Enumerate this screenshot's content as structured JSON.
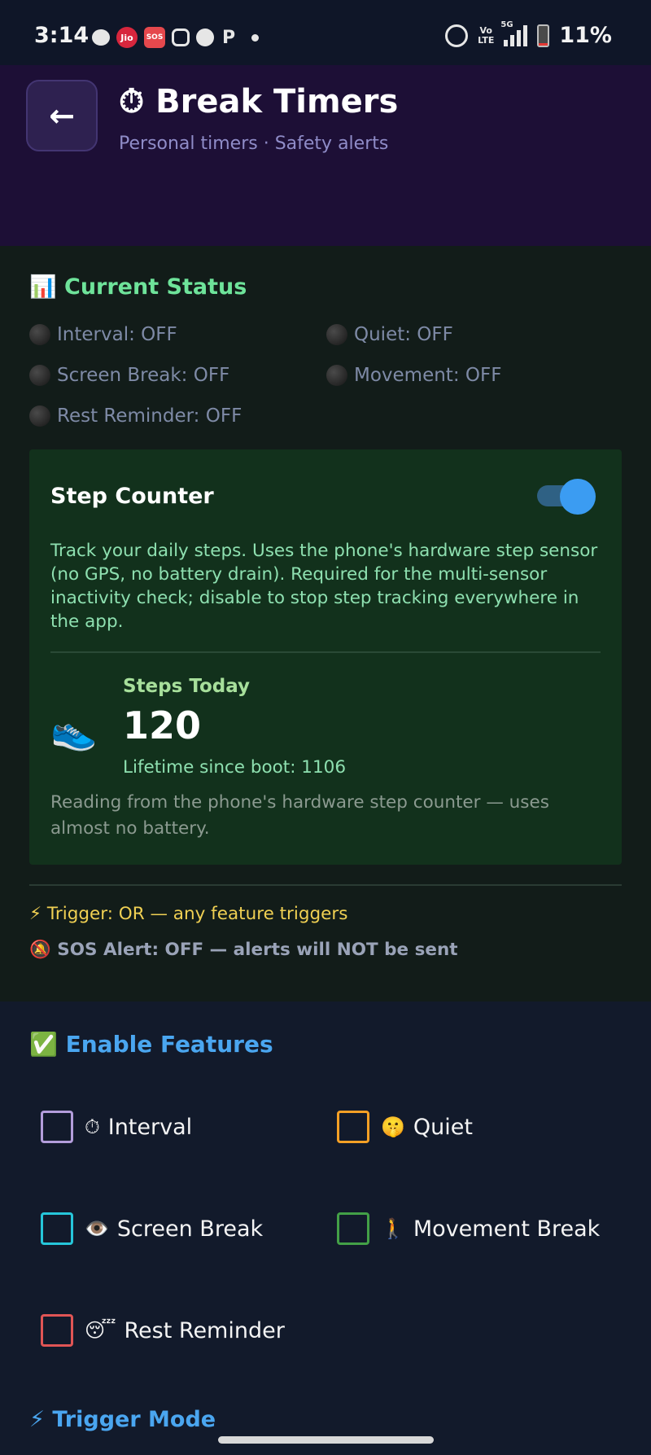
{
  "status_bar": {
    "time": "3:14",
    "jio_label": "Jio",
    "sos_label": "SOS",
    "p_label": "P",
    "volte_top": "Vo",
    "volte_bottom": "LTE",
    "network": "5G",
    "battery": "11%",
    "battery_level": 0.11
  },
  "header": {
    "back_icon": "←",
    "title": "⏱ Break Timers",
    "subtitle": "Personal timers · Safety alerts"
  },
  "current_status": {
    "title": "📊 Current Status",
    "items": [
      {
        "label": "Interval: OFF"
      },
      {
        "label": "Quiet: OFF"
      },
      {
        "label": "Screen Break: OFF"
      },
      {
        "label": "Movement: OFF"
      },
      {
        "label": "Rest Reminder: OFF"
      }
    ]
  },
  "step_counter": {
    "title": "Step Counter",
    "enabled": true,
    "description": "Track your daily steps. Uses the phone's hardware step sensor (no GPS, no battery drain). Required for the multi-sensor inactivity check; disable to stop step tracking everywhere in the app.",
    "icon": "👟",
    "steps_label": "Steps Today",
    "steps_value": "120",
    "lifetime": "Lifetime since boot: 1106",
    "note": "Reading from the phone's hardware step counter — uses almost no battery."
  },
  "trigger_info": "⚡ Trigger: OR — any feature triggers",
  "sos_info": "🔕 SOS Alert: OFF — alerts will NOT be sent",
  "features": {
    "title": "✅ Enable Features",
    "items": [
      {
        "icon": "⏱",
        "label": "Interval",
        "color": "#b39ddb"
      },
      {
        "icon": "🤫",
        "label": "Quiet",
        "color": "#f5a025"
      },
      {
        "icon": "👁️",
        "label": "Screen Break",
        "color": "#26c6da"
      },
      {
        "icon": "🚶",
        "label": "Movement Break",
        "color": "#43a047"
      },
      {
        "icon": "😴",
        "label": "Rest Reminder",
        "color": "#e05555"
      }
    ]
  },
  "trigger_mode_title": "⚡ Trigger Mode"
}
